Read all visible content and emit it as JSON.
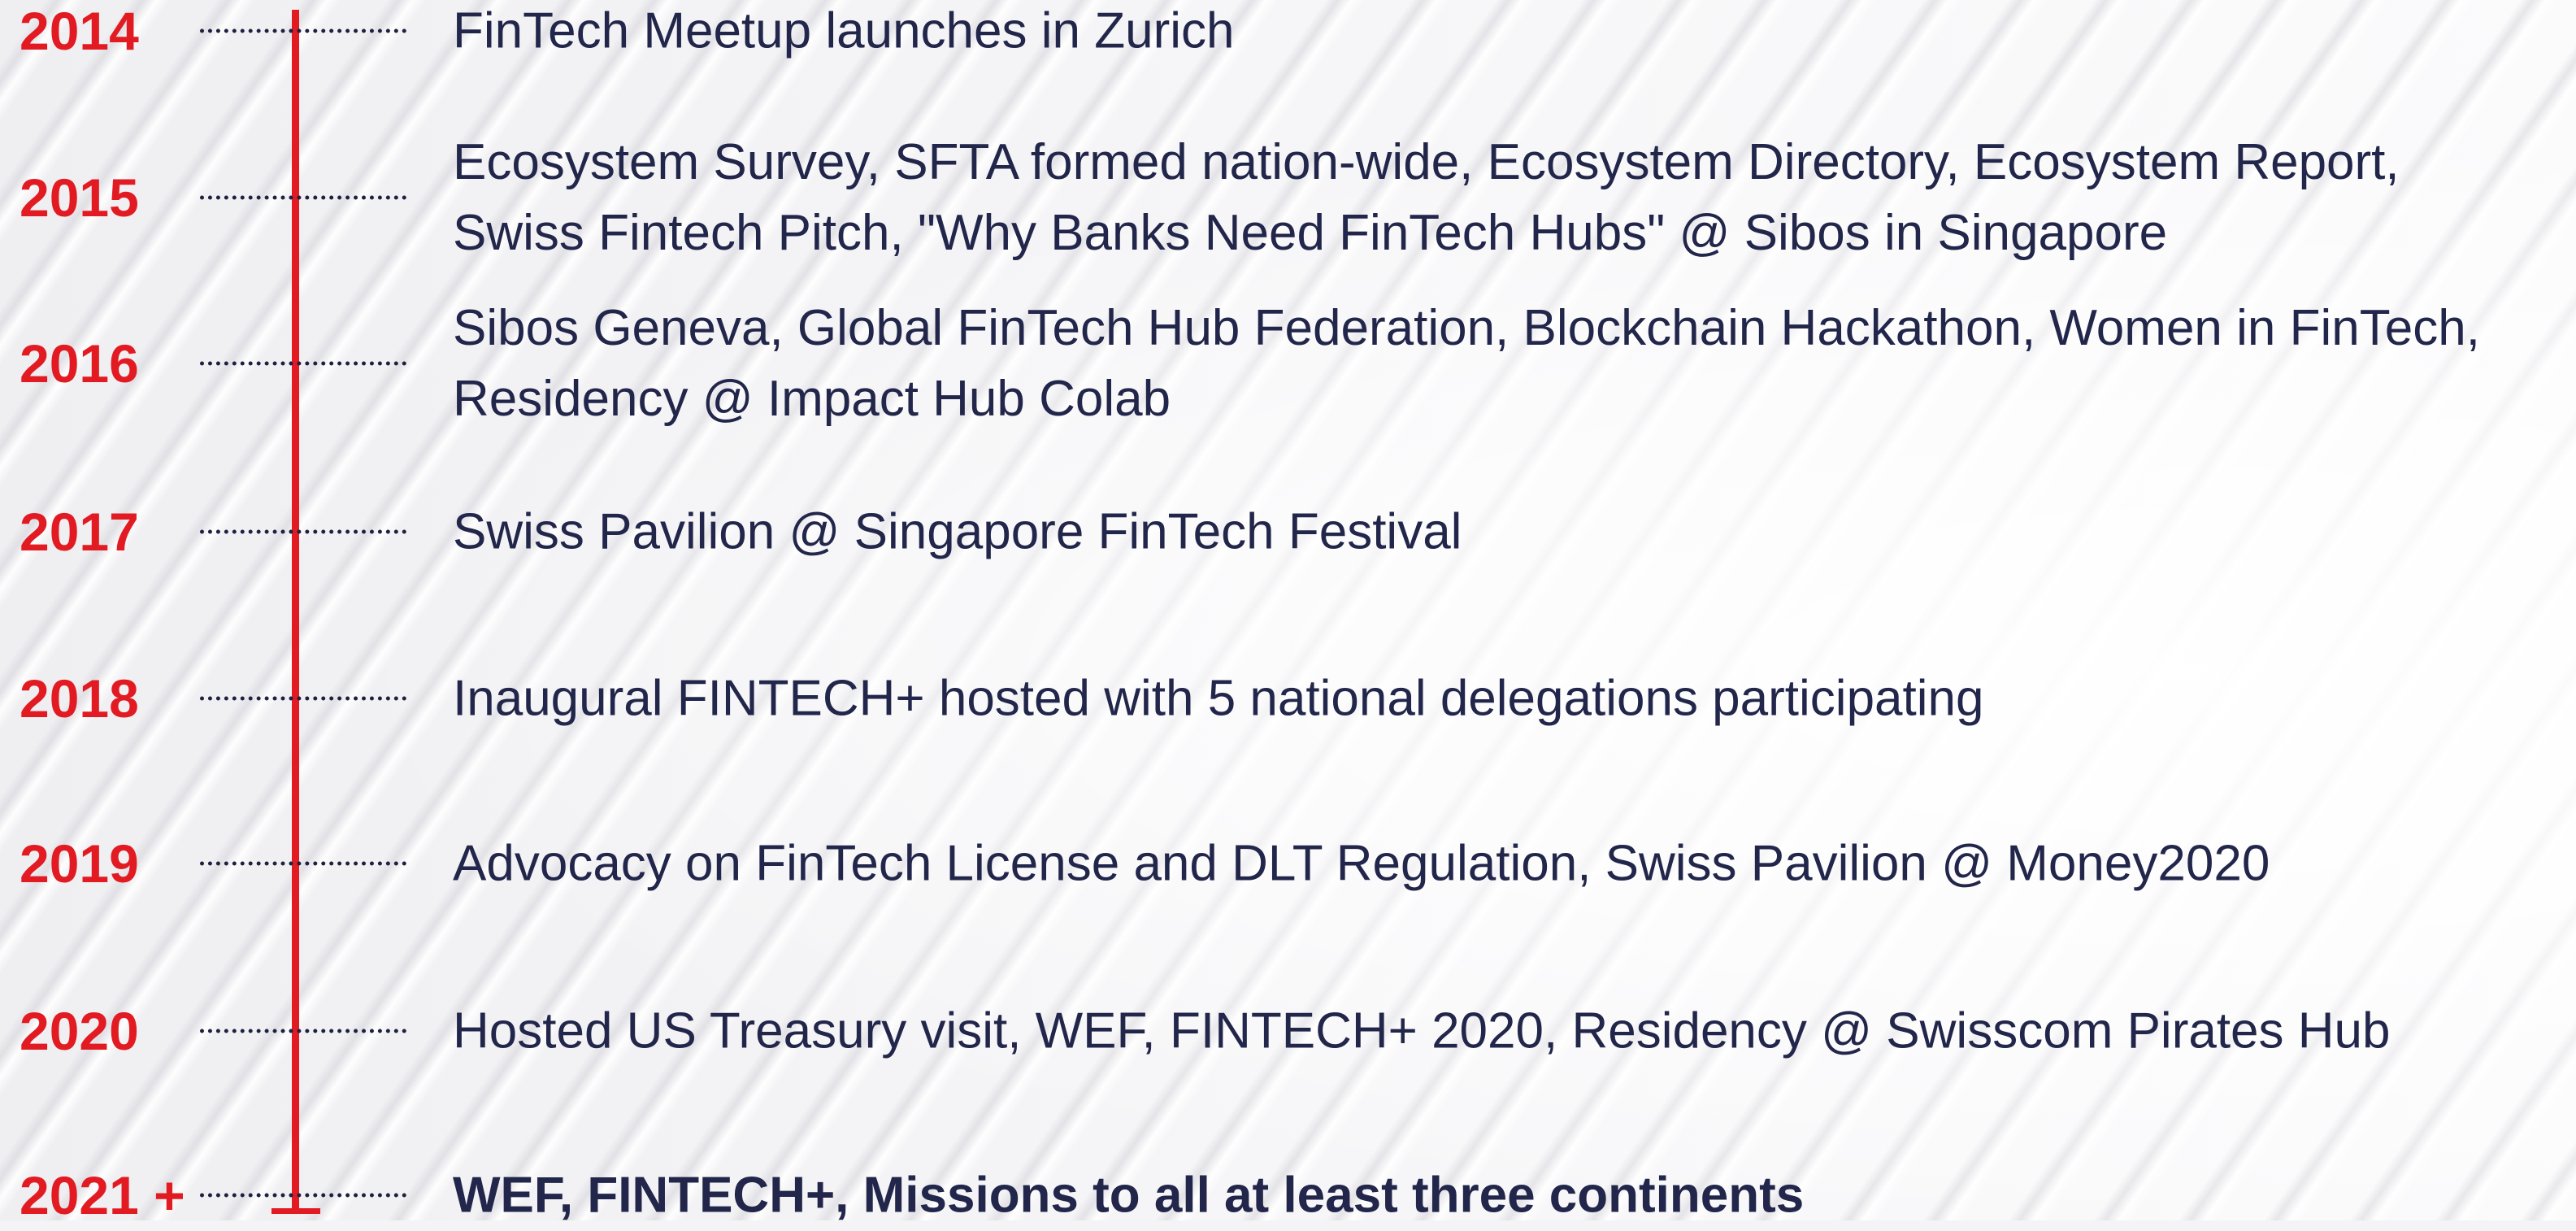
{
  "timeline": {
    "entries": [
      {
        "year": "2014",
        "lines": [
          "FinTech Meetup launches in Zurich"
        ]
      },
      {
        "year": "2015",
        "lines": [
          "Ecosystem Survey, SFTA formed nation-wide, Ecosystem Directory, Ecosystem Report,",
          "Swiss Fintech Pitch, \"Why Banks Need FinTech Hubs\" @ Sibos in Singapore"
        ]
      },
      {
        "year": "2016",
        "lines": [
          "Sibos Geneva, Global FinTech Hub Federation, Blockchain Hackathon, Women in FinTech,",
          "Residency @ Impact Hub Colab"
        ]
      },
      {
        "year": "2017",
        "lines": [
          "Swiss Pavilion @ Singapore FinTech Festival"
        ]
      },
      {
        "year": "2018",
        "lines": [
          "Inaugural FINTECH+ hosted with 5 national delegations participating"
        ]
      },
      {
        "year": "2019",
        "lines": [
          "Advocacy on FinTech License and DLT Regulation, Swiss Pavilion @ Money2020"
        ]
      },
      {
        "year": "2020",
        "lines": [
          "Hosted US Treasury visit, WEF, FINTECH+ 2020, Residency @ Swisscom Pirates Hub"
        ]
      },
      {
        "year": "2021 +",
        "lines": [
          "WEF, FINTECH+, Missions to all at least three continents"
        ],
        "emphasis": true
      }
    ]
  },
  "colors": {
    "accent": "#e21b23",
    "text": "#22264a",
    "connector": "#1e2040"
  }
}
